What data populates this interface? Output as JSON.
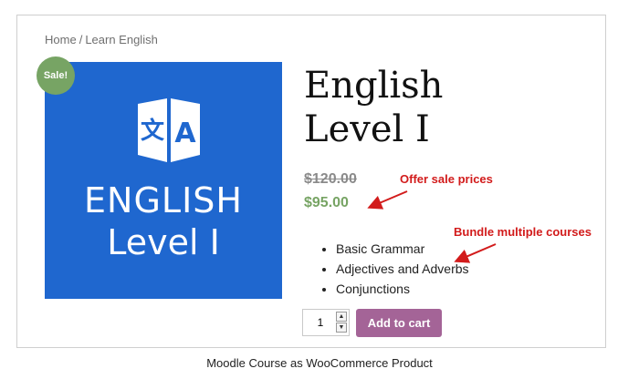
{
  "breadcrumb": {
    "home": "Home",
    "separator": "/",
    "current": "Learn English"
  },
  "badge": {
    "label": "Sale!",
    "color": "#77a464"
  },
  "image": {
    "line1": "ENGLISH",
    "line2": "Level I",
    "background": "#1f67cf",
    "icon": "translate-flag-icon"
  },
  "product": {
    "title_line1": "English",
    "title_line2": "Level I",
    "price_old": "$120.00",
    "price_new": "$95.00",
    "features": [
      "Basic Grammar",
      "Adjectives and Adverbs",
      "Conjunctions"
    ],
    "quantity": "1",
    "add_to_cart": "Add to cart",
    "button_color": "#a46497",
    "price_color": "#77a464"
  },
  "annotations": {
    "sale": "Offer sale prices",
    "bundle": "Bundle multiple courses",
    "color": "#d21b1b"
  },
  "caption": "Moodle Course as WooCommerce Product"
}
